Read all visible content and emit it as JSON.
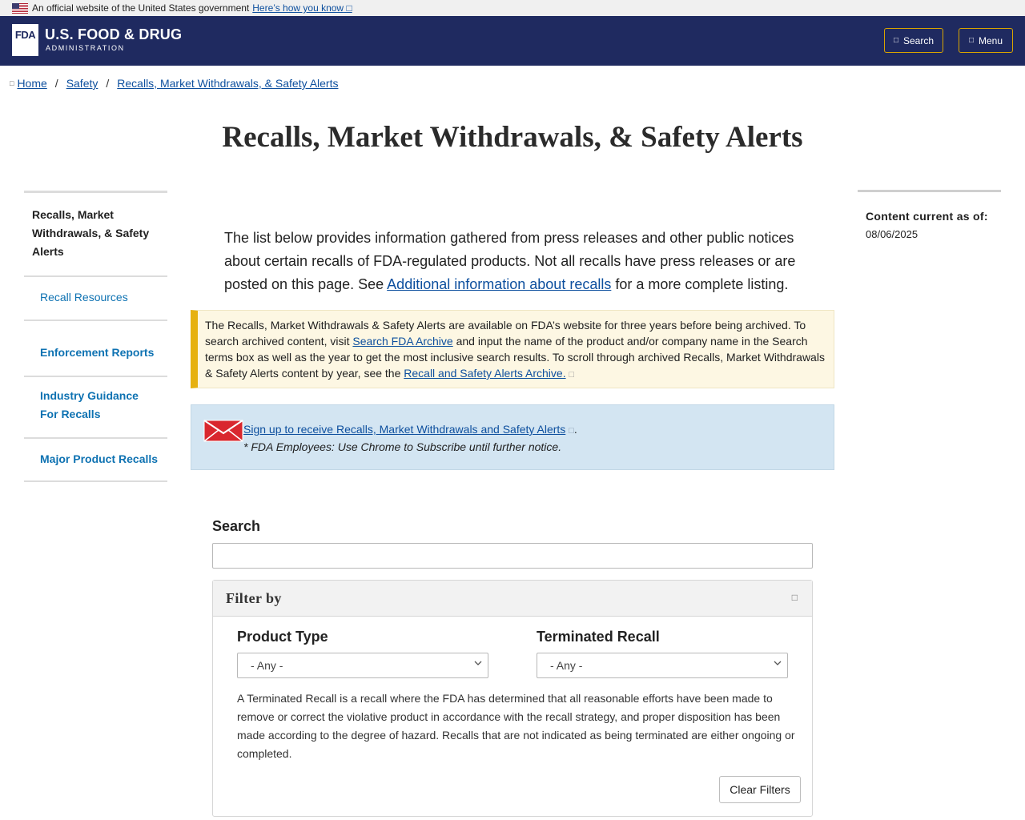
{
  "gov_banner": {
    "text": "An official website of the United States government",
    "link": "Here’s how you know",
    "link_icon": "□"
  },
  "header": {
    "logo_mark": "FDA",
    "logo_line1": "U.S. FOOD & DRUG",
    "logo_line2": "ADMINISTRATION",
    "search_label": "Search",
    "search_icon": "□",
    "menu_label": "Menu",
    "menu_icon": "□"
  },
  "breadcrumb": {
    "home_icon": "□",
    "items": [
      "Home",
      "Safety",
      "Recalls, Market Withdrawals, & Safety Alerts"
    ],
    "separator": "/"
  },
  "page_title": "Recalls, Market Withdrawals, & Safety Alerts",
  "left_nav": {
    "active": "Recalls, Market Withdrawals, & Safety Alerts",
    "items": [
      "Recall Resources",
      "Enforcement Reports",
      "Industry Guidance For Recalls",
      "Major Product Recalls"
    ]
  },
  "right_box": {
    "label": "Content current as of:",
    "date": "08/06/2025"
  },
  "intro": {
    "text_before": "The list below provides information gathered from press releases and other public notices about certain recalls of FDA-regulated products. Not all recalls have press releases or are posted on this page. See ",
    "link": "Additional information about recalls",
    "text_after": " for a more complete listing."
  },
  "archive_alert": {
    "text1": "The Recalls, Market Withdrawals & Safety Alerts are available on FDA’s website for three years before being archived. To search archived content, visit ",
    "link1": "Search FDA Archive",
    "text2": " and input the name of the product and/or company name in the Search terms box as well as the year to get the most inclusive search results. To scroll through archived Recalls, Market Withdrawals & Safety Alerts content by year, see the ",
    "link2": "Recall and Safety Alerts Archive.",
    "ext_icon": "□"
  },
  "signup": {
    "link": "Sign up to receive Recalls, Market Withdrawals and Safety Alerts",
    "ext_icon": "□",
    "period": ".",
    "note": "* FDA Employees: Use Chrome to Subscribe until further notice."
  },
  "search": {
    "label": "Search",
    "value": ""
  },
  "filter": {
    "heading": "Filter by",
    "collapse_icon": "□",
    "product_type_label": "Product Type",
    "product_type_value": "- Any -",
    "terminated_label": "Terminated Recall",
    "terminated_value": "- Any -",
    "terminated_desc": "A Terminated Recall is a recall where the FDA has determined that all reasonable efforts have been made to remove or correct the violative product in accordance with the recall strategy, and proper disposition has been made according to the degree of hazard. Recalls that are not indicated as being terminated are either ongoing or completed.",
    "clear_label": "Clear Filters"
  },
  "colors": {
    "header_bg": "#1f2a60",
    "button_border": "#d9a400",
    "link": "#0d4f9e",
    "nav_link": "#0e72b2",
    "alert_yellow_bar": "#e6b111",
    "alert_blue_bg": "#d3e5f2"
  }
}
